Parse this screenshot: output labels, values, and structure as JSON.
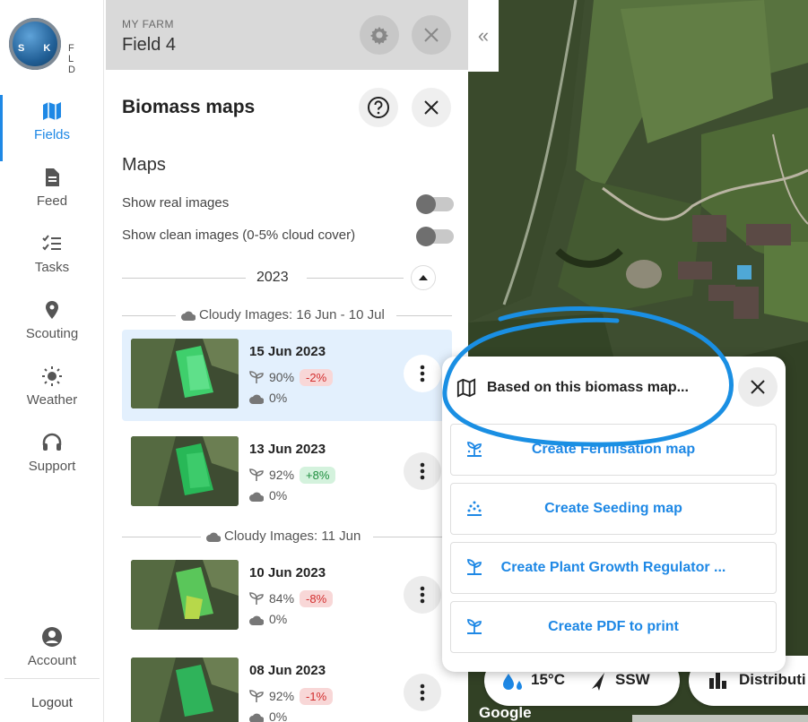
{
  "app": {
    "logo_letters_left": "S K Y",
    "logo_letters_right": "F L D"
  },
  "nav": {
    "items": [
      {
        "label": "Fields",
        "icon": "map-icon",
        "active": true
      },
      {
        "label": "Feed",
        "icon": "document-icon",
        "active": false
      },
      {
        "label": "Tasks",
        "icon": "checklist-icon",
        "active": false
      },
      {
        "label": "Scouting",
        "icon": "location-pin-icon",
        "active": false
      },
      {
        "label": "Weather",
        "icon": "sun-icon",
        "active": false
      },
      {
        "label": "Support",
        "icon": "headset-icon",
        "active": false
      }
    ],
    "account_label": "Account",
    "logout_label": "Logout"
  },
  "header": {
    "farm_label": "MY FARM",
    "field_name": "Field 4"
  },
  "panel": {
    "title": "Biomass maps",
    "section_title": "Maps",
    "toggles": [
      {
        "label": "Show real images",
        "on": false
      },
      {
        "label": "Show clean images (0-5% cloud cover)",
        "on": false
      }
    ],
    "year": "2023",
    "groups": [
      {
        "title": "Cloudy Images: 16 Jun - 10 Jul"
      },
      {
        "title": "Cloudy Images: 11 Jun"
      }
    ],
    "cards": [
      {
        "date": "15 Jun 2023",
        "biomass": "90%",
        "change": "-2%",
        "change_type": "negative",
        "cloud": "0%",
        "selected": true
      },
      {
        "date": "13 Jun 2023",
        "biomass": "92%",
        "change": "+8%",
        "change_type": "positive",
        "cloud": "0%",
        "selected": false
      },
      {
        "date": "10 Jun 2023",
        "biomass": "84%",
        "change": "-8%",
        "change_type": "negative",
        "cloud": "0%",
        "selected": false
      },
      {
        "date": "08 Jun 2023",
        "biomass": "92%",
        "change": "-1%",
        "change_type": "negative",
        "cloud": "0%",
        "selected": false
      }
    ]
  },
  "popup": {
    "title": "Based on this biomass map...",
    "actions": [
      {
        "label": "Create Fertilisation map",
        "icon": "fertiliser-icon"
      },
      {
        "label": "Create Seeding map",
        "icon": "seeding-icon"
      },
      {
        "label": "Create Plant Growth Regulator ...",
        "icon": "plant-regulator-icon"
      },
      {
        "label": "Create PDF to print",
        "icon": "plant-print-icon"
      }
    ]
  },
  "weather": {
    "temperature": "15°C",
    "wind": "SSW"
  },
  "distribution": {
    "label": "Distributi"
  },
  "map": {
    "provider": "Google"
  },
  "colors": {
    "accent": "#1e88e5",
    "annotation": "#1a8fe3",
    "negative": "#d32f2f",
    "positive": "#1e8e3e"
  }
}
